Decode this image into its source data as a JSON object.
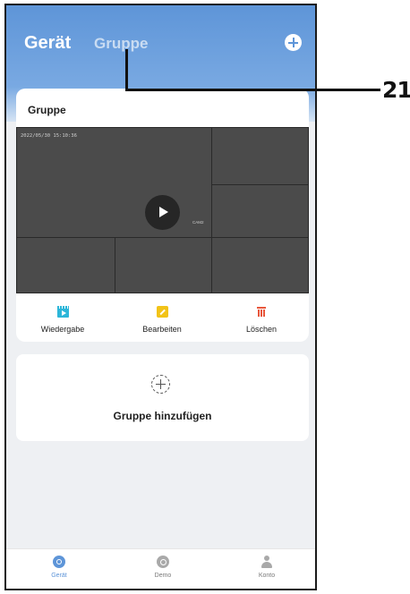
{
  "header": {
    "tab_device": "Gerät",
    "tab_group": "Gruppe"
  },
  "group_card": {
    "title": "Gruppe",
    "timestamp": "2022/05/30  15:10:36",
    "camera_label": "CAM2",
    "actions": [
      {
        "label": "Wiedergabe",
        "icon": "playback-icon",
        "color": "#2cb6d9"
      },
      {
        "label": "Bearbeiten",
        "icon": "edit-icon",
        "color": "#f2c318"
      },
      {
        "label": "Löschen",
        "icon": "delete-icon",
        "color": "#e8573c"
      }
    ]
  },
  "add_group": {
    "label": "Gruppe hinzufügen"
  },
  "bottom_nav": {
    "items": [
      {
        "label": "Gerät",
        "icon": "device-icon",
        "active": true
      },
      {
        "label": "Demo",
        "icon": "demo-icon",
        "active": false
      },
      {
        "label": "Konto",
        "icon": "account-icon",
        "active": false
      }
    ]
  },
  "callout": {
    "number": "21"
  },
  "colors": {
    "accent": "#5e95d8",
    "header_gradient_top": "#5e95d8",
    "background": "#eef0f3",
    "video_tile": "#4b4b4b"
  }
}
